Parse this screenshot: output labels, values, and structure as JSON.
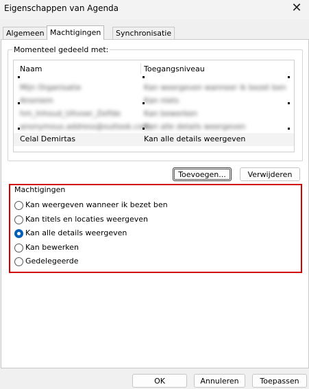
{
  "window": {
    "title": "Eigenschappen van Agenda",
    "close_glyph": "✕"
  },
  "tabs": [
    {
      "label": "Algemeen"
    },
    {
      "label": "Machtigingen"
    },
    {
      "label": "Synchronisatie"
    }
  ],
  "shared": {
    "legend": "Momenteel gedeeld met:",
    "col_name": "Naam",
    "col_access": "Toegangsniveau",
    "rows": [
      {
        "name": "Mijn Organisatie",
        "access": "Kan weergeven wanneer ik bezet ben"
      },
      {
        "name": "Anoniem",
        "access": "Kan niets"
      },
      {
        "name": "hm_Inhoud_Uitvoer_Zelfde",
        "access": "Kan bewerken"
      },
      {
        "name": "anonymous.address@outlook.com",
        "access": "Kan alle details weergeven"
      },
      {
        "name": "Celal Demirtas",
        "access": "Kan alle details weergeven"
      }
    ]
  },
  "buttons": {
    "add": "Toevoegen...",
    "remove": "Verwijderen",
    "ok": "OK",
    "cancel": "Annuleren",
    "apply": "Toepassen"
  },
  "permissions": {
    "legend": "Machtigingen",
    "options": [
      {
        "label": "Kan weergeven wanneer ik bezet ben",
        "checked": false
      },
      {
        "label": "Kan titels en locaties weergeven",
        "checked": false
      },
      {
        "label": "Kan alle details weergeven",
        "checked": true
      },
      {
        "label": "Kan bewerken",
        "checked": false
      },
      {
        "label": "Gedelegeerde",
        "checked": false
      }
    ]
  },
  "colors": {
    "highlight": "#d00000",
    "radio_accent": "#005fb8"
  }
}
